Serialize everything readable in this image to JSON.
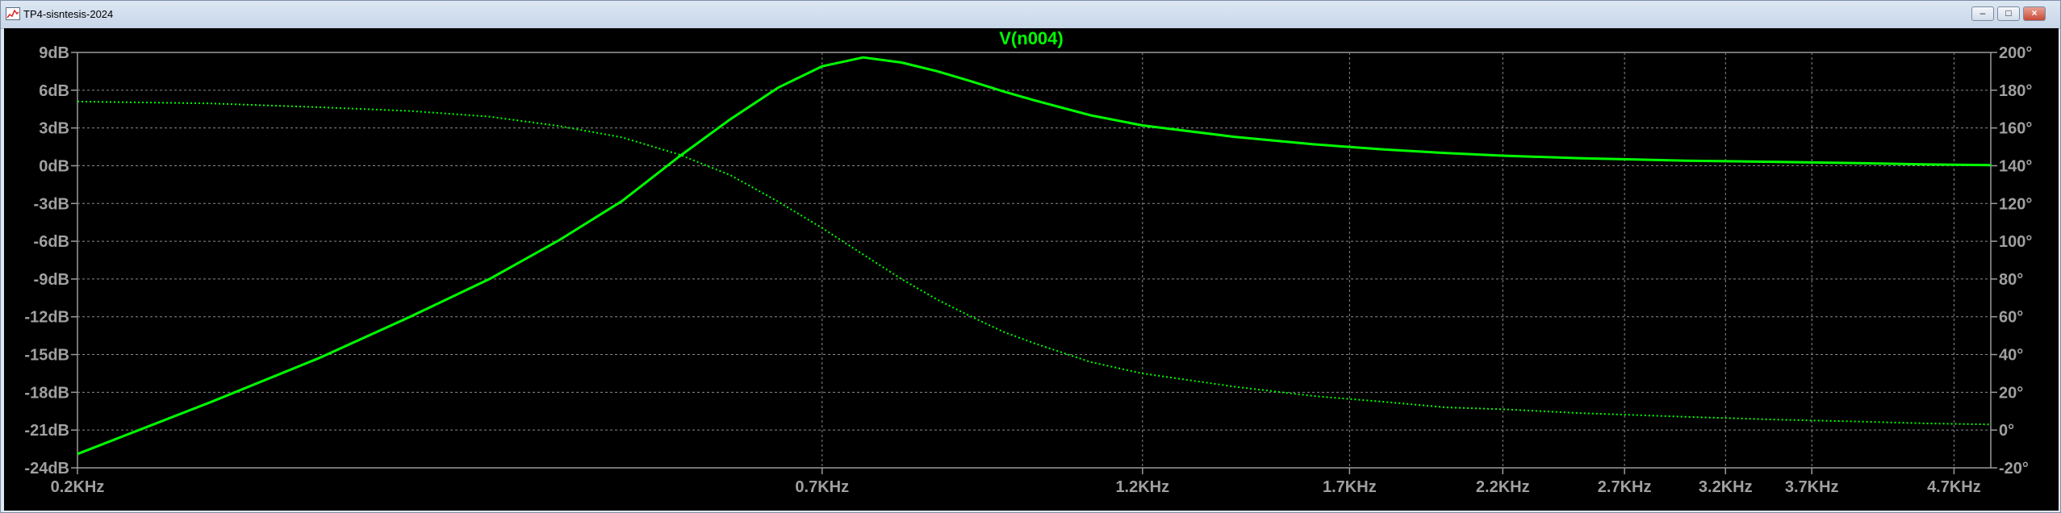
{
  "window": {
    "title": "TP4-sisntesis-2024",
    "minimize_label": "–",
    "maximize_label": "□",
    "close_label": "×"
  },
  "colors": {
    "background": "#000000",
    "grid": "#8a8a8a",
    "axis_text": "#a0a0a0",
    "trace": "#00ff00"
  },
  "chart_data": {
    "type": "line",
    "title": "V(n004)",
    "x_scale": "log",
    "x_unit": "KHz",
    "xlim": [
      0.2,
      5.0
    ],
    "x_ticks": [
      0.2,
      0.7,
      1.2,
      1.7,
      2.2,
      2.7,
      3.2,
      3.7,
      4.7
    ],
    "x_tick_labels": [
      "0.2KHz",
      "0.7KHz",
      "1.2KHz",
      "1.7KHz",
      "2.2KHz",
      "2.7KHz",
      "3.2KHz",
      "3.7KHz",
      "4.7KHz"
    ],
    "ylim_left": [
      -24,
      9
    ],
    "y_ticks_left": [
      9,
      6,
      3,
      0,
      -3,
      -6,
      -9,
      -12,
      -15,
      -18,
      -21,
      -24
    ],
    "y_tick_labels_left": [
      "9dB",
      "6dB",
      "3dB",
      "0dB",
      "-3dB",
      "-6dB",
      "-9dB",
      "-12dB",
      "-15dB",
      "-18dB",
      "-21dB",
      "-24dB"
    ],
    "ylim_right": [
      -20,
      200
    ],
    "y_ticks_right": [
      200,
      180,
      160,
      140,
      120,
      100,
      80,
      60,
      40,
      20,
      0,
      -20
    ],
    "y_tick_labels_right": [
      "200°",
      "180°",
      "160°",
      "140°",
      "120°",
      "100°",
      "80°",
      "60°",
      "40°",
      "20°",
      "0°",
      "-20°"
    ],
    "grid": true,
    "series": [
      {
        "axis": "left",
        "style": "solid",
        "x": [
          0.2,
          0.25,
          0.3,
          0.35,
          0.4,
          0.45,
          0.5,
          0.55,
          0.6,
          0.65,
          0.7,
          0.75,
          0.8,
          0.85,
          0.9,
          0.95,
          1.0,
          1.1,
          1.2,
          1.4,
          1.6,
          1.8,
          2.0,
          2.2,
          2.5,
          3.0,
          3.5,
          4.0,
          4.5,
          5.0
        ],
        "y": [
          -22.9,
          -18.8,
          -15.3,
          -12.0,
          -9.0,
          -5.9,
          -2.8,
          0.7,
          3.7,
          6.2,
          7.9,
          8.6,
          8.2,
          7.5,
          6.7,
          5.9,
          5.2,
          4.0,
          3.2,
          2.3,
          1.7,
          1.3,
          1.0,
          0.8,
          0.6,
          0.4,
          0.3,
          0.2,
          0.1,
          0.05
        ]
      },
      {
        "axis": "right",
        "style": "dotted",
        "x": [
          0.2,
          0.25,
          0.3,
          0.35,
          0.4,
          0.45,
          0.5,
          0.55,
          0.6,
          0.65,
          0.7,
          0.75,
          0.8,
          0.85,
          0.9,
          0.95,
          1.0,
          1.1,
          1.2,
          1.4,
          1.6,
          1.8,
          2.0,
          2.2,
          2.5,
          3.0,
          3.5,
          4.0,
          4.5,
          5.0
        ],
        "y": [
          174,
          173,
          171,
          169,
          166,
          161,
          155,
          146,
          135,
          121,
          107,
          93,
          80,
          69,
          60,
          52,
          46,
          36,
          30,
          23,
          18,
          15,
          12,
          11,
          9,
          7,
          5.5,
          4.5,
          3.5,
          3
        ]
      }
    ]
  }
}
